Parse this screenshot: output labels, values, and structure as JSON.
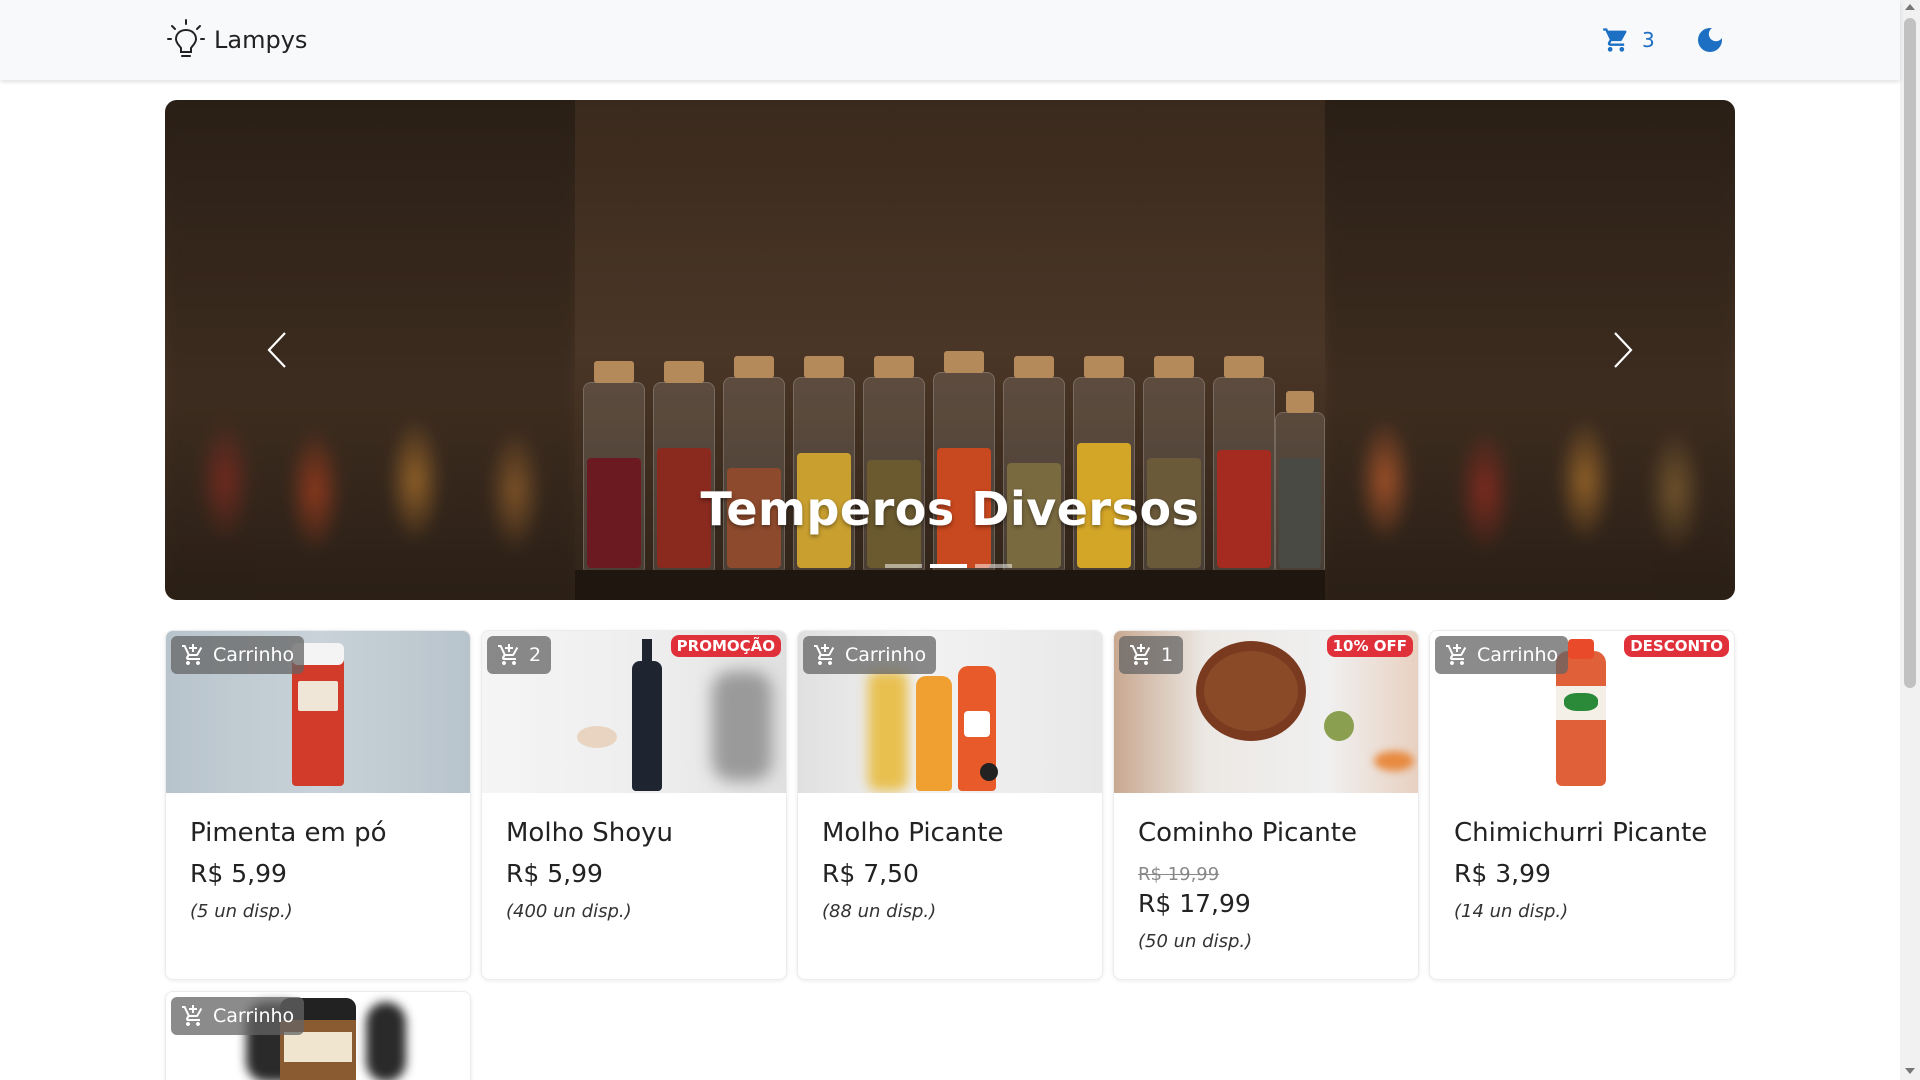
{
  "header": {
    "brand": "Lampys",
    "cart_count": "3"
  },
  "carousel": {
    "caption": "Temperos Diversos",
    "active_slide": 2,
    "slide_count": 3
  },
  "products": [
    {
      "title": "Pimenta em pó",
      "price": "R$ 5,99",
      "stock": "(5 un disp.)",
      "cart_label": "Carrinho",
      "badge": ""
    },
    {
      "title": "Molho Shoyu",
      "price": "R$ 5,99",
      "stock": "(400 un disp.)",
      "cart_label": "2",
      "badge": "PROMOÇÃO"
    },
    {
      "title": "Molho Picante",
      "price": "R$ 7,50",
      "stock": "(88 un disp.)",
      "cart_label": "Carrinho",
      "badge": ""
    },
    {
      "title": "Cominho Picante",
      "old_price": "R$ 19,99",
      "price": "R$ 17,99",
      "stock": "(50 un disp.)",
      "cart_label": "1",
      "badge": "10% OFF"
    },
    {
      "title": "Chimichurri Picante",
      "price": "R$ 3,99",
      "stock": "(14 un disp.)",
      "cart_label": "Carrinho",
      "badge": "DESCONTO"
    },
    {
      "cart_label": "Carrinho",
      "badge": ""
    }
  ],
  "colors": {
    "accent": "#1c6fc2",
    "badge_red": "#e0303a",
    "header_bg": "#f8f9fa"
  }
}
